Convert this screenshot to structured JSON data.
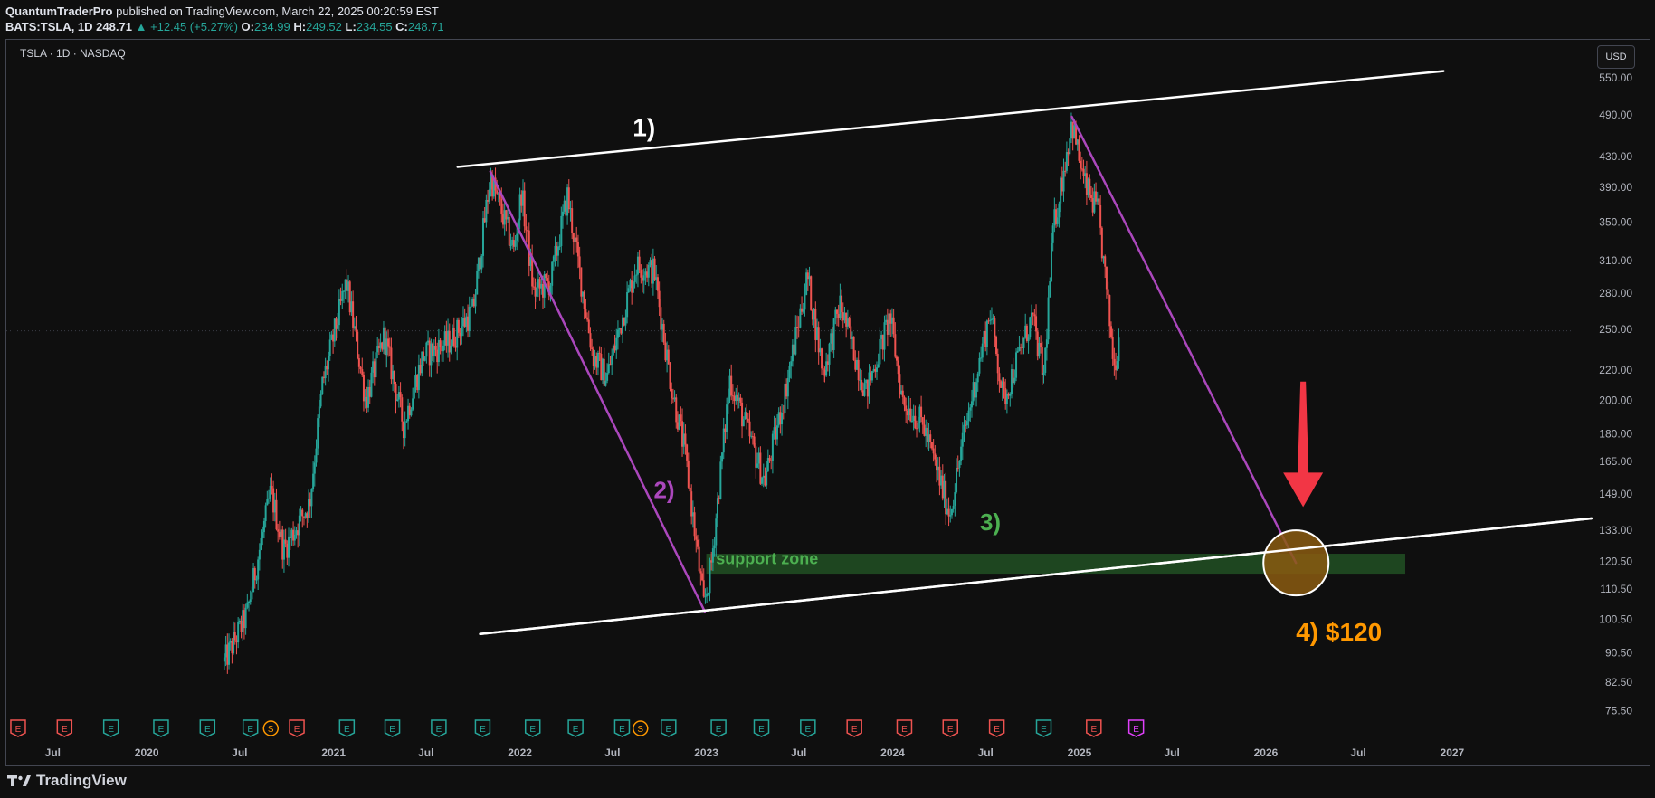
{
  "header": {
    "publisher": "QuantumTraderPro",
    "published": "published on TradingView.com, March 22, 2025 00:20:59 EST",
    "symbol": "BATS:TSLA, 1D",
    "last": "248.71",
    "arrow": "▲",
    "change": "+12.45 (+5.27%)",
    "o_label": "O:",
    "o_val": "234.99",
    "h_label": "H:",
    "h_val": "249.52",
    "l_label": "L:",
    "l_val": "234.55",
    "c_label": "C:",
    "c_val": "248.71"
  },
  "chart_label": "TSLA · 1D · NASDAQ",
  "currency_button": "USD",
  "footer": {
    "logo": "TradingView"
  },
  "colors": {
    "up": "#26a69a",
    "down": "#ef5350",
    "purple": "#ab47bc",
    "green_label": "#4caf50",
    "orange": "#ff9800",
    "arrow": "#f23645",
    "zone": "#2e7d32",
    "white": "#ffffff"
  },
  "chart_data": {
    "type": "candlestick",
    "scale": "log",
    "ylim": [
      72,
      620
    ],
    "xlim": [
      "2019-04-01",
      "2027-09-01"
    ],
    "y_ticks": [
      "550.00",
      "490.00",
      "430.00",
      "390.00",
      "350.00",
      "310.00",
      "280.00",
      "250.00",
      "220.00",
      "200.00",
      "180.00",
      "165.00",
      "149.00",
      "133.00",
      "120.50",
      "110.50",
      "100.50",
      "90.50",
      "82.50",
      "75.50"
    ],
    "x_ticks": [
      {
        "label": "Jul",
        "date": "2019-07-01"
      },
      {
        "label": "2020",
        "date": "2020-01-01"
      },
      {
        "label": "Jul",
        "date": "2020-07-01"
      },
      {
        "label": "2021",
        "date": "2021-01-01"
      },
      {
        "label": "Jul",
        "date": "2021-07-01"
      },
      {
        "label": "2022",
        "date": "2022-01-01"
      },
      {
        "label": "Jul",
        "date": "2022-07-01"
      },
      {
        "label": "2023",
        "date": "2023-01-01"
      },
      {
        "label": "Jul",
        "date": "2023-07-01"
      },
      {
        "label": "2024",
        "date": "2024-01-01"
      },
      {
        "label": "Jul",
        "date": "2024-07-01"
      },
      {
        "label": "2025",
        "date": "2025-01-01"
      },
      {
        "label": "Jul",
        "date": "2025-07-01"
      },
      {
        "label": "2026",
        "date": "2026-01-01"
      },
      {
        "label": "Jul",
        "date": "2026-07-01"
      },
      {
        "label": "2027",
        "date": "2027-01-01"
      }
    ],
    "price_path": [
      [
        "2020-06-01",
        88
      ],
      [
        "2020-07-15",
        102
      ],
      [
        "2020-08-31",
        150
      ],
      [
        "2020-09-25",
        125
      ],
      [
        "2020-11-15",
        145
      ],
      [
        "2020-12-10",
        210
      ],
      [
        "2021-01-26",
        290
      ],
      [
        "2021-03-05",
        200
      ],
      [
        "2021-04-10",
        245
      ],
      [
        "2021-05-18",
        185
      ],
      [
        "2021-06-25",
        230
      ],
      [
        "2021-08-15",
        240
      ],
      [
        "2021-10-01",
        265
      ],
      [
        "2021-11-04",
        404
      ],
      [
        "2021-12-20",
        320
      ],
      [
        "2022-01-04",
        385
      ],
      [
        "2022-01-28",
        280
      ],
      [
        "2022-03-02",
        290
      ],
      [
        "2022-04-04",
        380
      ],
      [
        "2022-05-24",
        230
      ],
      [
        "2022-06-20",
        215
      ],
      [
        "2022-08-16",
        305
      ],
      [
        "2022-09-21",
        300
      ],
      [
        "2022-10-24",
        210
      ],
      [
        "2022-11-20",
        170
      ],
      [
        "2022-12-27",
        105
      ],
      [
        "2023-01-10",
        118
      ],
      [
        "2023-02-16",
        214
      ],
      [
        "2023-04-25",
        155
      ],
      [
        "2023-06-01",
        200
      ],
      [
        "2023-07-18",
        295
      ],
      [
        "2023-08-18",
        218
      ],
      [
        "2023-09-20",
        270
      ],
      [
        "2023-11-10",
        205
      ],
      [
        "2023-12-27",
        260
      ],
      [
        "2024-01-20",
        200
      ],
      [
        "2024-03-01",
        185
      ],
      [
        "2024-04-22",
        140
      ],
      [
        "2024-05-20",
        180
      ],
      [
        "2024-07-10",
        265
      ],
      [
        "2024-08-05",
        200
      ],
      [
        "2024-09-30",
        260
      ],
      [
        "2024-10-23",
        215
      ],
      [
        "2024-11-10",
        340
      ],
      [
        "2024-12-17",
        479
      ],
      [
        "2025-01-10",
        395
      ],
      [
        "2025-02-07",
        360
      ],
      [
        "2025-03-10",
        222
      ],
      [
        "2025-03-21",
        248.71
      ]
    ],
    "earnings_markers": [
      {
        "date": "2019-04-24",
        "type": "E",
        "color": "#ef5350"
      },
      {
        "date": "2019-07-24",
        "type": "E",
        "color": "#ef5350"
      },
      {
        "date": "2019-10-23",
        "type": "E",
        "color": "#26a69a"
      },
      {
        "date": "2020-01-29",
        "type": "E",
        "color": "#26a69a"
      },
      {
        "date": "2020-04-29",
        "type": "E",
        "color": "#26a69a"
      },
      {
        "date": "2020-07-22",
        "type": "E",
        "color": "#26a69a"
      },
      {
        "date": "2020-08-31",
        "type": "S",
        "color": "#ff9800"
      },
      {
        "date": "2020-10-21",
        "type": "E",
        "color": "#ef5350"
      },
      {
        "date": "2021-01-27",
        "type": "E",
        "color": "#26a69a"
      },
      {
        "date": "2021-04-26",
        "type": "E",
        "color": "#26a69a"
      },
      {
        "date": "2021-07-26",
        "type": "E",
        "color": "#26a69a"
      },
      {
        "date": "2021-10-20",
        "type": "E",
        "color": "#26a69a"
      },
      {
        "date": "2022-01-26",
        "type": "E",
        "color": "#26a69a"
      },
      {
        "date": "2022-04-20",
        "type": "E",
        "color": "#26a69a"
      },
      {
        "date": "2022-07-20",
        "type": "E",
        "color": "#26a69a"
      },
      {
        "date": "2022-08-25",
        "type": "S",
        "color": "#ff9800"
      },
      {
        "date": "2022-10-19",
        "type": "E",
        "color": "#26a69a"
      },
      {
        "date": "2023-01-25",
        "type": "E",
        "color": "#26a69a"
      },
      {
        "date": "2023-04-19",
        "type": "E",
        "color": "#26a69a"
      },
      {
        "date": "2023-07-19",
        "type": "E",
        "color": "#26a69a"
      },
      {
        "date": "2023-10-18",
        "type": "E",
        "color": "#ef5350"
      },
      {
        "date": "2024-01-24",
        "type": "E",
        "color": "#ef5350"
      },
      {
        "date": "2024-04-23",
        "type": "E",
        "color": "#ef5350"
      },
      {
        "date": "2024-07-23",
        "type": "E",
        "color": "#ef5350"
      },
      {
        "date": "2024-10-23",
        "type": "E",
        "color": "#26a69a"
      },
      {
        "date": "2025-01-29",
        "type": "E",
        "color": "#ef5350"
      },
      {
        "date": "2025-04-22",
        "type": "E",
        "color": "#e040fb"
      }
    ],
    "drawings": {
      "upper_channel": {
        "from": [
          "2021-09-01",
          416
        ],
        "to": [
          "2026-12-15",
          562
        ]
      },
      "lower_channel": {
        "from": [
          "2021-10-15",
          96
        ],
        "to": [
          "2027-10-01",
          138
        ]
      },
      "purple_line_1": {
        "from": [
          "2021-11-04",
          410
        ],
        "to": [
          "2022-12-29",
          103
        ]
      },
      "purple_line_2": {
        "from": [
          "2024-12-17",
          487
        ],
        "to": [
          "2026-03-01",
          120
        ]
      },
      "support_zone": {
        "from": "2023-01-01",
        "to": "2026-10-01",
        "low": 116,
        "high": 123.5
      },
      "target_circle": {
        "date": "2026-03-01",
        "price": 120
      },
      "down_arrow": {
        "date": "2026-03-15",
        "top": 212,
        "bottom": 143
      }
    },
    "annotations": [
      {
        "text": "1)",
        "date": "2022-08-10",
        "price": 458,
        "color": "#ffffff",
        "size": 28
      },
      {
        "text": "2)",
        "date": "2022-09-20",
        "price": 147,
        "color": "#ab47bc",
        "size": 26
      },
      {
        "text": "3)",
        "date": "2024-06-20",
        "price": 133,
        "color": "#4caf50",
        "size": 26
      },
      {
        "text": "support zone",
        "date": "2023-01-20",
        "price": 119.5,
        "color": "#4caf50",
        "size": 18
      },
      {
        "text": "4)  $120",
        "date": "2026-03-01",
        "price": 94,
        "color": "#ff9800",
        "size": 28
      }
    ]
  }
}
